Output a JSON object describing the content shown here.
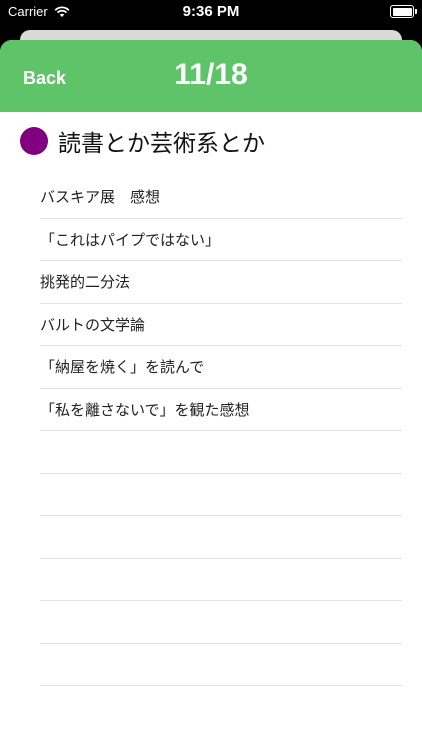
{
  "status": {
    "carrier": "Carrier",
    "time": "9:36 PM"
  },
  "header": {
    "back_label": "Back",
    "counter": "11/18",
    "color": "#5fc36a"
  },
  "category": {
    "title": "読書とか芸術系とか",
    "dot_color": "#800080"
  },
  "items": [
    "バスキア展　感想",
    "「これはパイプではない」",
    "挑発的二分法",
    "バルトの文学論",
    "「納屋を焼く」を読んで",
    "「私を離さないで」を観た感想",
    "",
    "",
    "",
    "",
    "",
    ""
  ]
}
